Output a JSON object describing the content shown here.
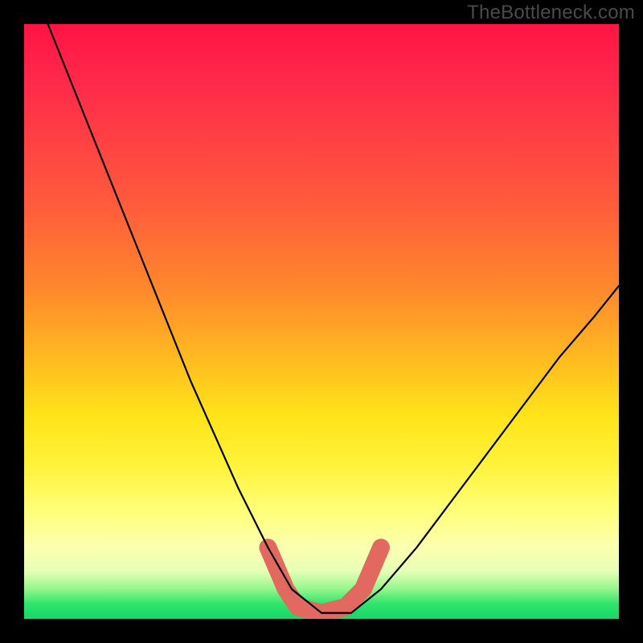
{
  "watermark": {
    "text": "TheBottleneck.com"
  },
  "chart_data": {
    "type": "line",
    "title": "",
    "xlabel": "",
    "ylabel": "",
    "xlim": [
      0,
      100
    ],
    "ylim": [
      0,
      100
    ],
    "series": [
      {
        "name": "bottleneck-curve",
        "x": [
          4,
          8,
          12,
          16,
          20,
          24,
          28,
          32,
          36,
          41,
          45,
          50,
          55,
          60,
          66,
          72,
          78,
          84,
          90,
          96,
          100
        ],
        "values": [
          100,
          90,
          80,
          70,
          60,
          50,
          40,
          31,
          22,
          12,
          5,
          1,
          1,
          5,
          12,
          20,
          28,
          36,
          44,
          51,
          56
        ]
      }
    ],
    "annotations": [
      {
        "name": "bottom-arms",
        "color": "#e2695f",
        "x": [
          41,
          44,
          46,
          50,
          54,
          57,
          60
        ],
        "values": [
          12,
          5,
          2,
          1,
          2,
          5,
          12
        ]
      }
    ],
    "grid": false,
    "legend": false,
    "background_gradient": {
      "orientation": "vertical",
      "stops": [
        {
          "pos": 0.0,
          "color": "#ff1445"
        },
        {
          "pos": 0.3,
          "color": "#ff5a3c"
        },
        {
          "pos": 0.58,
          "color": "#ffc21e"
        },
        {
          "pos": 0.74,
          "color": "#fff23a"
        },
        {
          "pos": 0.92,
          "color": "#e6ffb6"
        },
        {
          "pos": 1.0,
          "color": "#16d66a"
        }
      ]
    }
  }
}
